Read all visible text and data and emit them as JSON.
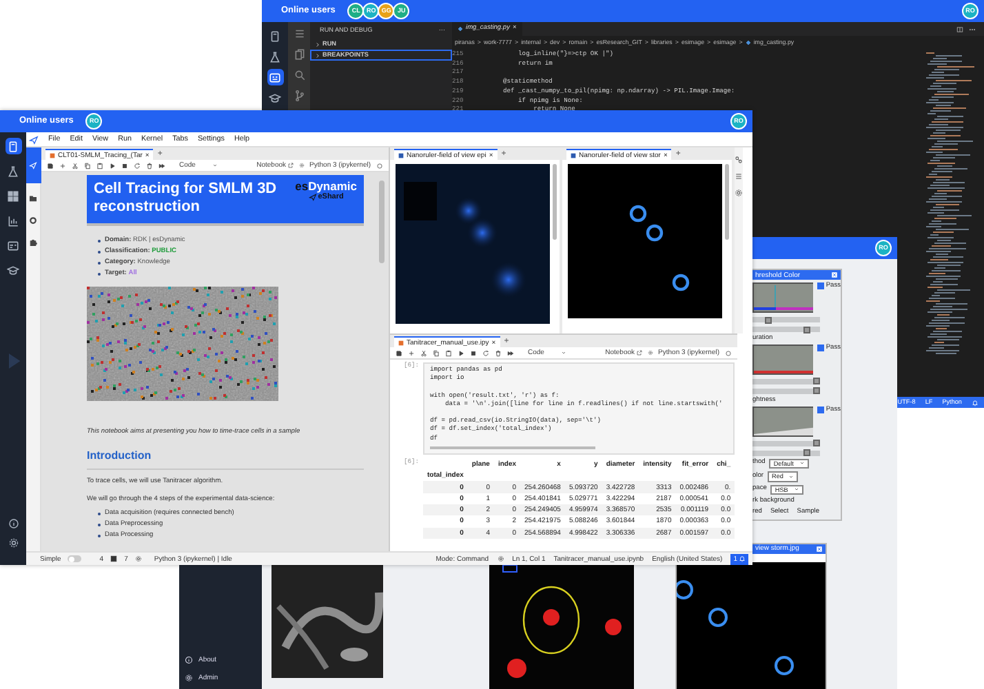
{
  "editor_window": {
    "header": {
      "title": "Online users",
      "avatars": [
        {
          "initials": "CL",
          "color": "#1fae86"
        },
        {
          "initials": "RO",
          "color": "#1cb3c4"
        },
        {
          "initials": "GG",
          "color": "#e8a21a"
        },
        {
          "initials": "JU",
          "color": "#1fae86"
        }
      ],
      "user": "RO"
    },
    "rail": [
      {
        "kind": "notebook",
        "selected": false
      },
      {
        "kind": "flask",
        "selected": false
      },
      {
        "kind": "debug",
        "selected": true
      },
      {
        "kind": "cap",
        "selected": false
      }
    ],
    "side_panel": {
      "title": "RUN AND DEBUG",
      "menu": "···",
      "sections": [
        {
          "label": "RUN",
          "selected": false
        },
        {
          "label": "BREAKPOINTS",
          "selected": true
        }
      ]
    },
    "tab": {
      "label": "img_casting.py",
      "close": "×"
    },
    "breadcrumb": {
      "separator": ">",
      "items": [
        "piranas",
        "work-7777",
        "internal",
        "dev",
        "romain",
        "esResearch_GIT",
        "libraries",
        "esimage",
        "esimage",
        "img_casting.py"
      ]
    },
    "code": [
      {
        "line": "215",
        "text": "        log_inline(\"}=>ctp OK |\")"
      },
      {
        "line": "216",
        "text": "        return im"
      },
      {
        "line": "217"
      },
      {
        "line": "218",
        "text": "    @staticmethod"
      },
      {
        "line": "219",
        "text": "    def _cast_numpy_to_pil(npimg: np.ndarray) -> PIL.Image.Image:"
      },
      {
        "line": "220",
        "text": "        if npimg is None:"
      },
      {
        "line": "221",
        "text": "            return None"
      }
    ],
    "status_bar": [
      "UTF-8",
      "LF",
      "Python"
    ]
  },
  "app_window": {
    "header": {
      "user": "RO"
    },
    "sidebar": [
      {
        "label": "About",
        "kind": "info"
      },
      {
        "label": "Admin",
        "kind": "gear"
      }
    ],
    "threshold_dialog": {
      "title": "hreshold Color",
      "sections": [
        {
          "pass": "Pass",
          "checked": true,
          "sliders": [
            {
              "level": 0.2
            },
            {
              "level": 0.85
            }
          ]
        },
        {
          "label": "uration",
          "pass": "Pass",
          "checked": true,
          "sliders": [
            {
              "level": 1
            },
            {
              "level": 1
            }
          ]
        },
        {
          "label": "ghtness",
          "pass": "Pass",
          "checked": true,
          "sliders": [
            {
              "level": 1
            },
            {
              "level": 0.85
            }
          ]
        }
      ],
      "fields": [
        {
          "label": "thod",
          "value": "Default"
        },
        {
          "label": "olor",
          "value": "Red"
        },
        {
          "label": "pace",
          "value": "HSB"
        }
      ],
      "background_label": "rk background",
      "buttons": [
        "red",
        "Select",
        "Sample"
      ]
    },
    "image_window": {
      "title": "view storm.jpg"
    }
  },
  "notebook_window": {
    "header": {
      "title": "Online users",
      "avatars": [
        {
          "initials": "RO",
          "color": "#1cb3c4"
        }
      ],
      "user": "RO"
    },
    "rail": [
      {
        "kind": "notebook",
        "selected": true
      },
      {
        "kind": "flask",
        "selected": false
      },
      {
        "kind": "grid",
        "selected": false
      },
      {
        "kind": "chart",
        "selected": false
      },
      {
        "kind": "card",
        "selected": false
      },
      {
        "kind": "cap",
        "selected": false
      }
    ],
    "menu": [
      "File",
      "Edit",
      "View",
      "Run",
      "Kernel",
      "Tabs",
      "Settings",
      "Help"
    ],
    "sidebar": [
      {
        "kind": "logo",
        "selected": true
      },
      {
        "kind": "folder",
        "selected": false
      },
      {
        "kind": "circle",
        "selected": false
      },
      {
        "kind": "puzzle",
        "selected": false
      }
    ],
    "main_notebook": {
      "tab": "CLT01-SMLM_Tracing_(Tar",
      "close": "×",
      "add": "+",
      "toolbar": {
        "cell_type": "Code",
        "notebook": "Notebook",
        "kernel": "Python 3 (ipykernel)"
      },
      "banner": {
        "title": "Cell Tracing for SMLM 3D reconstruction",
        "logo_prefix": "es",
        "logo_name": "Dynamic",
        "tagline": "eShard"
      },
      "meta": [
        {
          "label": "Domain:",
          "value": "RDK | esDynamic"
        },
        {
          "label": "Classification:",
          "value": "PUBLIC",
          "color": "#1e9b3a"
        },
        {
          "label": "Category:",
          "value": "Knowledge"
        },
        {
          "label": "Target:",
          "value": "All",
          "color": "#a070e0"
        }
      ],
      "intro": "This notebook aims at presenting you how to time-trace cells in a sample",
      "heading": "Introduction",
      "paragraphs": [
        "To trace cells, we will use Tanitracer algorithm.",
        "We will go through the 4 steps of the experimental data-science:"
      ],
      "steps": [
        "Data acquisition (requires connected bench)",
        "Data Preprocessing",
        "Data Processing"
      ]
    },
    "image_tabs": [
      {
        "label": "Nanoruler-field of view epi",
        "close": "×",
        "add": "+",
        "kind": "epi"
      },
      {
        "label": "Nanoruler-field of view stor",
        "close": "×",
        "add": "+",
        "kind": "storm"
      }
    ],
    "second_notebook": {
      "tab": "Tanitracer_manual_use.ipy",
      "close": "×",
      "add": "+",
      "toolbar": {
        "cell_type": "Code",
        "notebook": "Notebook",
        "kernel": "Python 3 (ipykernel)"
      },
      "input_prompt": "[6]:",
      "code_blocks": [
        [
          "import pandas as pd",
          "import io"
        ],
        [
          "with open('result.txt', 'r') as f:",
          "    data = '\\n'.join([line for line in f.readlines() if not line.startswith('"
        ],
        [
          "df = pd.read_csv(io.StringIO(data), sep='\\t')",
          "df = df.set_index('total_index')",
          "df"
        ]
      ],
      "output_prompt": "[6]:",
      "table": {
        "columns": [
          "",
          "plane",
          "index",
          "x",
          "y",
          "diameter",
          "intensity",
          "fit_error",
          "chi_"
        ],
        "index_name": "total_index",
        "rows": [
          [
            "0",
            "0",
            "0",
            "254.260468",
            "5.093720",
            "3.422728",
            "3313",
            "0.002486",
            "0."
          ],
          [
            "0",
            "1",
            "0",
            "254.401841",
            "5.029771",
            "3.422294",
            "2187",
            "0.000541",
            "0.0"
          ],
          [
            "0",
            "2",
            "0",
            "254.249405",
            "4.959974",
            "3.368570",
            "2535",
            "0.001119",
            "0.0"
          ],
          [
            "0",
            "3",
            "2",
            "254.421975",
            "5.088246",
            "3.601844",
            "1870",
            "0.000363",
            "0.0"
          ],
          [
            "0",
            "4",
            "0",
            "254.568894",
            "4.998422",
            "3.306336",
            "2687",
            "0.001597",
            "0.0"
          ]
        ]
      }
    },
    "status_bar": {
      "simple": "Simple",
      "simple_on": false,
      "terminals": "4",
      "kernels": "7",
      "kernel_status": "Python 3 (ipykernel) | Idle",
      "mode": "Mode: Command",
      "position": "Ln 1, Col 1",
      "file": "Tanitracer_manual_use.ipynb",
      "language": "English (United States)",
      "notifications": "1"
    }
  }
}
